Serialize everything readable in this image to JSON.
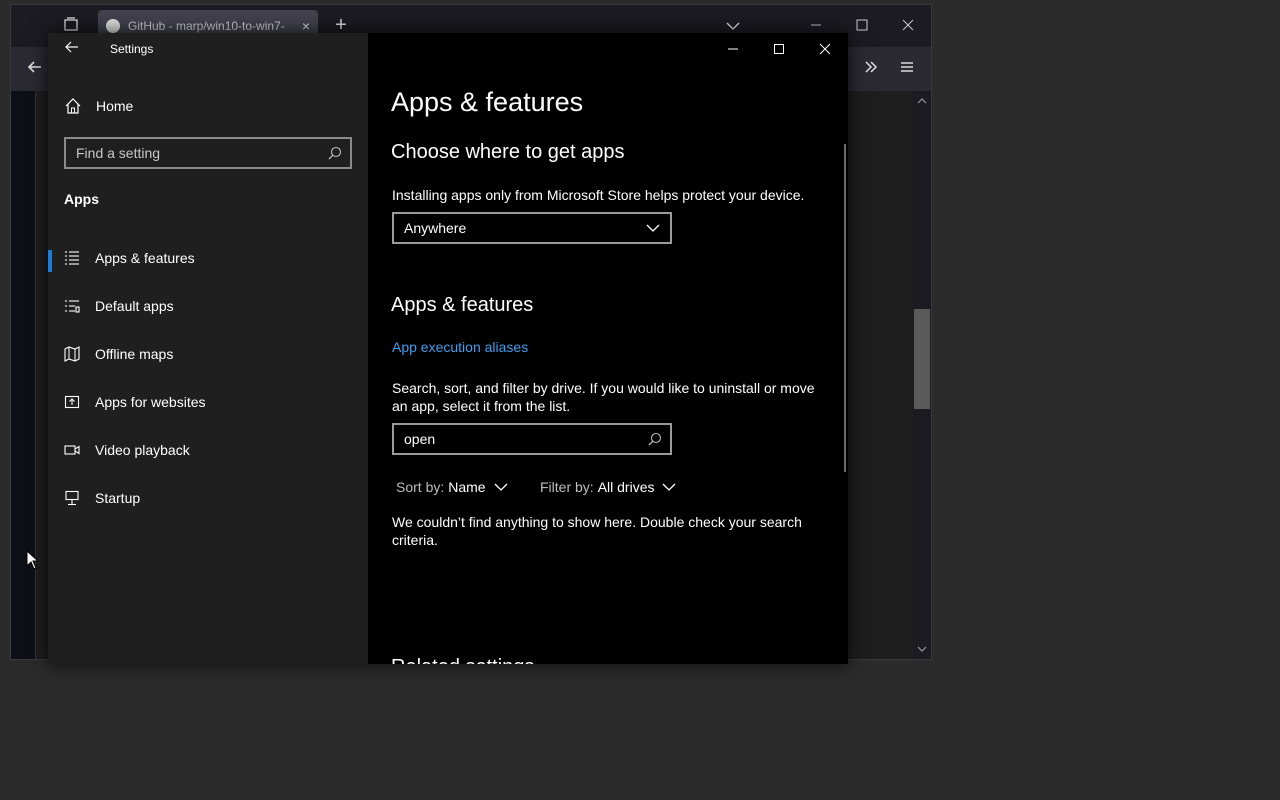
{
  "browser": {
    "tab_title": "GitHub - marp/win10-to-win7-",
    "tab_close": "×",
    "new_tab": "+"
  },
  "settings": {
    "window_title": "Settings",
    "nav": {
      "home_label": "Home",
      "search_placeholder": "Find a setting",
      "section_label": "Apps",
      "items": [
        {
          "label": "Apps & features",
          "icon": "list-icon",
          "selected": true
        },
        {
          "label": "Default apps",
          "icon": "default-apps-icon",
          "selected": false
        },
        {
          "label": "Offline maps",
          "icon": "map-icon",
          "selected": false
        },
        {
          "label": "Apps for websites",
          "icon": "link-window-icon",
          "selected": false
        },
        {
          "label": "Video playback",
          "icon": "video-icon",
          "selected": false
        },
        {
          "label": "Startup",
          "icon": "startup-icon",
          "selected": false
        }
      ]
    },
    "main": {
      "page_title": "Apps & features",
      "choose_heading": "Choose where to get apps",
      "choose_desc": "Installing apps only from Microsoft Store helps protect your device.",
      "source_dropdown_value": "Anywhere",
      "apps_heading": "Apps & features",
      "aliases_link": "App execution aliases",
      "search_desc": "Search, sort, and filter by drive. If you would like to uninstall or move an app, select it from the list.",
      "app_search_value": "open",
      "sort_label": "Sort by:",
      "sort_value": "Name",
      "filter_label": "Filter by:",
      "filter_value": "All drives",
      "empty_message": "We couldn’t find anything to show here. Double check your search criteria.",
      "related_heading": "Related settings"
    }
  },
  "colors": {
    "accent": "#1a7fd4",
    "link": "#3f9fef",
    "nav_bg": "#1f1f1f",
    "main_bg": "#000000"
  }
}
